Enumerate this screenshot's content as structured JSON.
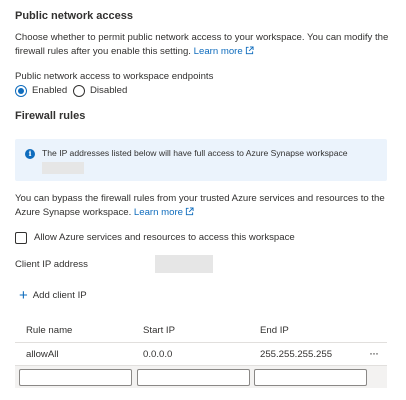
{
  "public_access": {
    "title": "Public network access",
    "description": "Choose whether to permit public network access to your workspace. You can modify the firewall rules after you enable this setting.",
    "learn_more": "Learn more",
    "endpoint_label": "Public network access to workspace endpoints",
    "options": [
      {
        "label": "Enabled",
        "selected": true
      },
      {
        "label": "Disabled",
        "selected": false
      }
    ]
  },
  "firewall": {
    "title": "Firewall rules",
    "info_text": "The IP addresses listed below will have full access to Azure Synapse workspace",
    "bypass_text": "You can bypass the firewall rules from your trusted Azure services and resources to the Azure Synapse workspace.",
    "learn_more": "Learn more",
    "allow_azure_label": "Allow Azure services and resources to access this workspace",
    "allow_azure_checked": false,
    "client_ip_label": "Client IP address",
    "add_client_ip_label": "Add client IP"
  },
  "table": {
    "columns": [
      "Rule name",
      "Start IP",
      "End IP"
    ],
    "rows": [
      {
        "rule_name": "allowAll",
        "start_ip": "0.0.0.0",
        "end_ip": "255.255.255.255"
      }
    ],
    "more_label": "···"
  },
  "colors": {
    "accent": "#0f6cbd",
    "info_background": "#ebf3fc",
    "text": "#323130"
  }
}
